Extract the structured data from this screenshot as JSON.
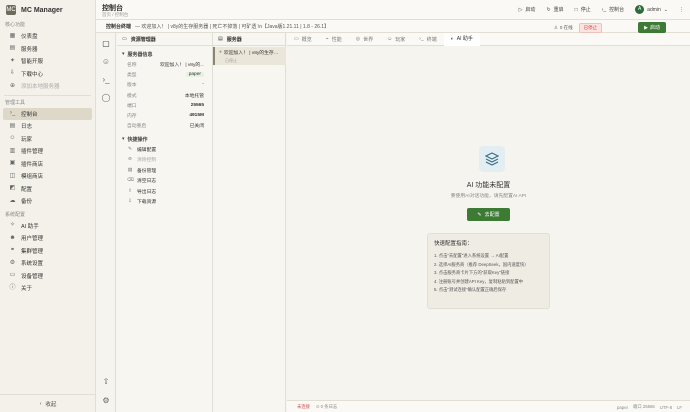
{
  "app": {
    "name": "MC Manager",
    "logo": "MC"
  },
  "sidebar": {
    "sections": [
      {
        "title": "核心功能",
        "items": [
          {
            "label": "仪表盘",
            "icon": "dashboard-icon",
            "glyph": "▦"
          },
          {
            "label": "服务器",
            "icon": "server-icon",
            "glyph": "▤"
          },
          {
            "label": "智能开服",
            "icon": "wand-icon",
            "glyph": "✦"
          },
          {
            "label": "下载中心",
            "icon": "download-icon",
            "glyph": "⇩"
          },
          {
            "label": "添加本地服务器",
            "icon": "add-circle-icon",
            "glyph": "⊕",
            "muted": true
          }
        ]
      },
      {
        "title": "管理工具",
        "items": [
          {
            "label": "控制台",
            "icon": "terminal-icon",
            "glyph": "›_",
            "active": true
          },
          {
            "label": "日志",
            "icon": "log-icon",
            "glyph": "▤"
          },
          {
            "label": "玩家",
            "icon": "players-icon",
            "glyph": "☺"
          },
          {
            "label": "插件管理",
            "icon": "plugin-icon",
            "glyph": "▥"
          },
          {
            "label": "插件商店",
            "icon": "store-icon",
            "glyph": "▣"
          },
          {
            "label": "模组商店",
            "icon": "mod-store-icon",
            "glyph": "◫"
          },
          {
            "label": "配置",
            "icon": "config-icon",
            "glyph": "◩"
          },
          {
            "label": "备份",
            "icon": "backup-icon",
            "glyph": "☁"
          }
        ]
      },
      {
        "title": "系统配置",
        "items": [
          {
            "label": "AI 助手",
            "icon": "ai-icon",
            "glyph": "✧"
          },
          {
            "label": "用户管理",
            "icon": "users-icon",
            "glyph": "☻"
          },
          {
            "label": "集群管理",
            "icon": "cluster-icon",
            "glyph": "⚭"
          },
          {
            "label": "系统设置",
            "icon": "gear-icon",
            "glyph": "⚙"
          },
          {
            "label": "设备管理",
            "icon": "device-icon",
            "glyph": "▭"
          },
          {
            "label": "关于",
            "icon": "info-icon",
            "glyph": "ⓘ"
          }
        ]
      }
    ],
    "collapse_label": "收起"
  },
  "topbar": {
    "title": "控制台",
    "breadcrumb": "首页 / 控制台",
    "start_label": "启动",
    "restart_label": "重启",
    "stop_label": "停止",
    "console_label": "控制台",
    "user": "admin",
    "avatar": "A"
  },
  "infobar": {
    "prefix": "控制台终端",
    "motd": "— 欢迎加入！ | v8y的生存服务器 | 死亡不掉落 | 可矿透 \\n【Java版1.21.11 | 1.8 - 26.1】",
    "online": "0 在线",
    "status": "已停止",
    "start_label": "启动"
  },
  "resource_manager": {
    "title": "资源管理器",
    "info_group": "服务器信息",
    "info": [
      {
        "k": "名称",
        "v": "欢迎加入！ | v8y的…"
      },
      {
        "k": "类型",
        "v": "paper",
        "badge": true
      },
      {
        "k": "版本",
        "v": "-"
      },
      {
        "k": "模式",
        "v": "本地托管"
      },
      {
        "k": "端口",
        "v": "25565",
        "bold": true
      },
      {
        "k": "内存",
        "v": "4915M",
        "bold": true
      },
      {
        "k": "自动重启",
        "v": "已关闭"
      }
    ],
    "actions_group": "快捷操作",
    "actions": [
      {
        "label": "编辑配置",
        "glyph": "✎"
      },
      {
        "label": "清除控制",
        "glyph": "⊘",
        "muted": true
      },
      {
        "label": "备份管理",
        "glyph": "▤"
      },
      {
        "label": "清空日志",
        "glyph": "⌫"
      },
      {
        "label": "导出日志",
        "glyph": "⇪"
      },
      {
        "label": "下载资源",
        "glyph": "⇩"
      }
    ]
  },
  "server_list": {
    "title": "服务器",
    "item_name": "欢迎加入！ | v8y的生存…",
    "item_status": "已停止"
  },
  "tabs": [
    {
      "label": "概览",
      "glyph": "▭"
    },
    {
      "label": "性能",
      "glyph": "⌁"
    },
    {
      "label": "世界",
      "glyph": "◎"
    },
    {
      "label": "玩家",
      "glyph": "☺"
    },
    {
      "label": "终端",
      "glyph": "›_"
    },
    {
      "label": "AI 助手",
      "glyph": "◐",
      "active": true
    }
  ],
  "ai": {
    "title": "AI 功能未配置",
    "desc": "要使用AI对话功能，请先配置AI API",
    "button": "去配置",
    "guide_title": "快速配置指南：",
    "steps": [
      "1. 点击\"去配置\"进入系统设置 → AI配置",
      "2. 选择AI服务商（推荐 DeepSeek，国内速度快）",
      "3. 点击服务商卡片下方的\"获取Key\"链接",
      "4. 注册账号并创建API Key，复制粘贴到配置中",
      "5. 点击\"测试连接\"确认配置正确后保存"
    ]
  },
  "statusbar": {
    "left1": "未连接",
    "left2": "⊙ 0 条日志",
    "right1": "paper",
    "right2": "端口 25565",
    "right3": "UTF-8",
    "right4": "LF"
  },
  "colors": {
    "accent": "#3d7a34",
    "danger": "#cc4444",
    "active_nav": "#ddd8c8"
  }
}
